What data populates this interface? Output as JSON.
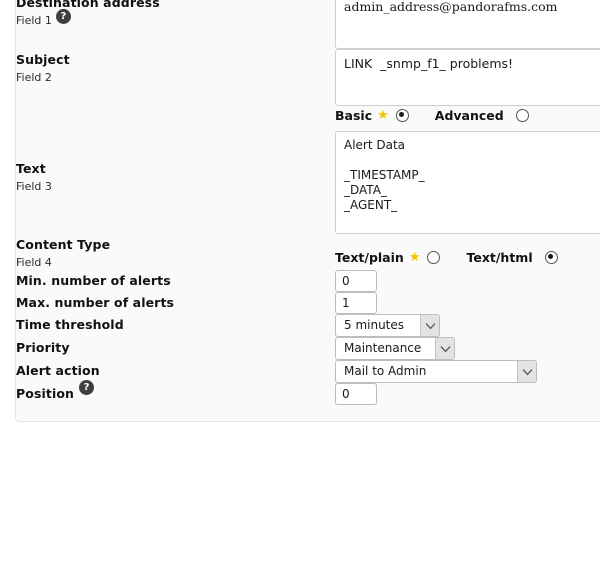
{
  "panel": {
    "background": "#fafafa",
    "border_color": "#e2e2e2"
  },
  "colors": {
    "star": "#f5c400",
    "help_icon_bg": "#3f3f3f",
    "text": "#111111",
    "input_border": "#cfcfcf"
  },
  "icons": {
    "help": "?",
    "star": "★"
  },
  "rows": [
    {
      "label": "Destination address",
      "sub": "Field 1",
      "has_help": true,
      "help_position": "after-sub",
      "value": "admin_address@pandorafms.com",
      "control": "textarea-serif"
    },
    {
      "label": "Subject",
      "sub": "Field 2",
      "has_help": false,
      "value": "LINK  _snmp_f1_ problems!",
      "control": "textarea-sans"
    },
    {
      "label": "Text",
      "sub": "Field 3",
      "has_help": false,
      "value": "Alert Data\n\n_TIMESTAMP_\n_DATA_\n_AGENT_",
      "control": "textarea-with-toggle",
      "toggle": {
        "options": [
          {
            "label": "Basic",
            "starred": true,
            "selected": true
          },
          {
            "label": "Advanced",
            "starred": false,
            "selected": false
          }
        ]
      }
    },
    {
      "label": "Content Type",
      "sub": "Field 4",
      "has_help": false,
      "control": "radio-group",
      "options": [
        {
          "label": "Text/plain",
          "starred": true,
          "selected": false
        },
        {
          "label": "Text/html",
          "starred": false,
          "selected": true
        }
      ]
    },
    {
      "label": "Min. number of alerts",
      "sub": "",
      "has_help": false,
      "value": "0",
      "control": "text-small"
    },
    {
      "label": "Max. number of alerts",
      "sub": "",
      "has_help": false,
      "value": "1",
      "control": "text-small"
    },
    {
      "label": "Time threshold",
      "sub": "",
      "has_help": false,
      "value": "5 minutes",
      "control": "select-time"
    },
    {
      "label": "Priority",
      "sub": "",
      "has_help": false,
      "value": "Maintenance",
      "control": "select-priority"
    },
    {
      "label": "Alert action",
      "sub": "",
      "has_help": false,
      "value": "Mail to Admin",
      "control": "select-action"
    },
    {
      "label": "Position",
      "sub": "",
      "has_help": true,
      "help_position": "inline",
      "value": "0",
      "control": "text-small"
    }
  ]
}
